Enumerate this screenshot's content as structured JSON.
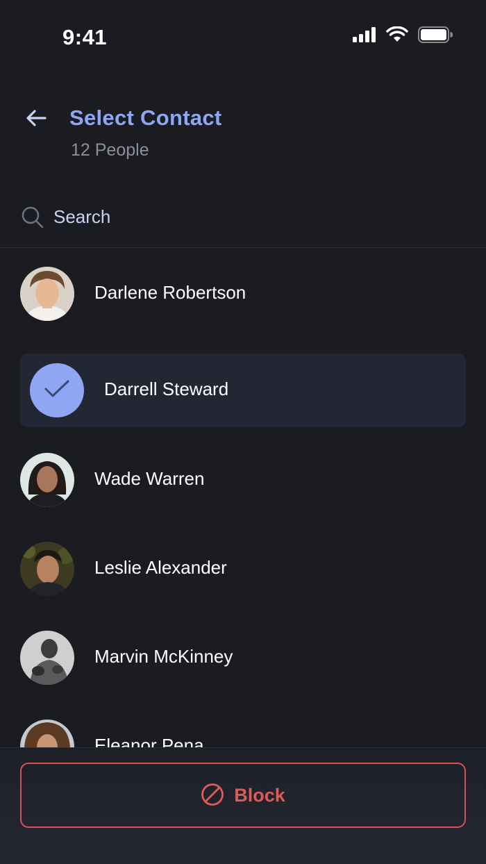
{
  "status_bar": {
    "time": "9:41",
    "icons": [
      "signal-icon",
      "wifi-icon",
      "battery-icon"
    ]
  },
  "header": {
    "back_icon": "arrow-left-icon",
    "title": "Select Contact",
    "subtitle": "12 People"
  },
  "search": {
    "icon": "search-icon",
    "placeholder": "Search",
    "value": ""
  },
  "contacts": [
    {
      "name": "Darlene Robertson",
      "selected": false
    },
    {
      "name": "Darrell Steward",
      "selected": true
    },
    {
      "name": "Wade Warren",
      "selected": false
    },
    {
      "name": "Leslie Alexander",
      "selected": false
    },
    {
      "name": "Marvin McKinney",
      "selected": false
    },
    {
      "name": "Eleanor Pena",
      "selected": false
    }
  ],
  "action": {
    "icon": "block-icon",
    "label": "Block"
  },
  "colors": {
    "background": "#1b1c21",
    "accent": "#8ea6f3",
    "danger": "#e05a56",
    "selected_row": "#232733"
  }
}
